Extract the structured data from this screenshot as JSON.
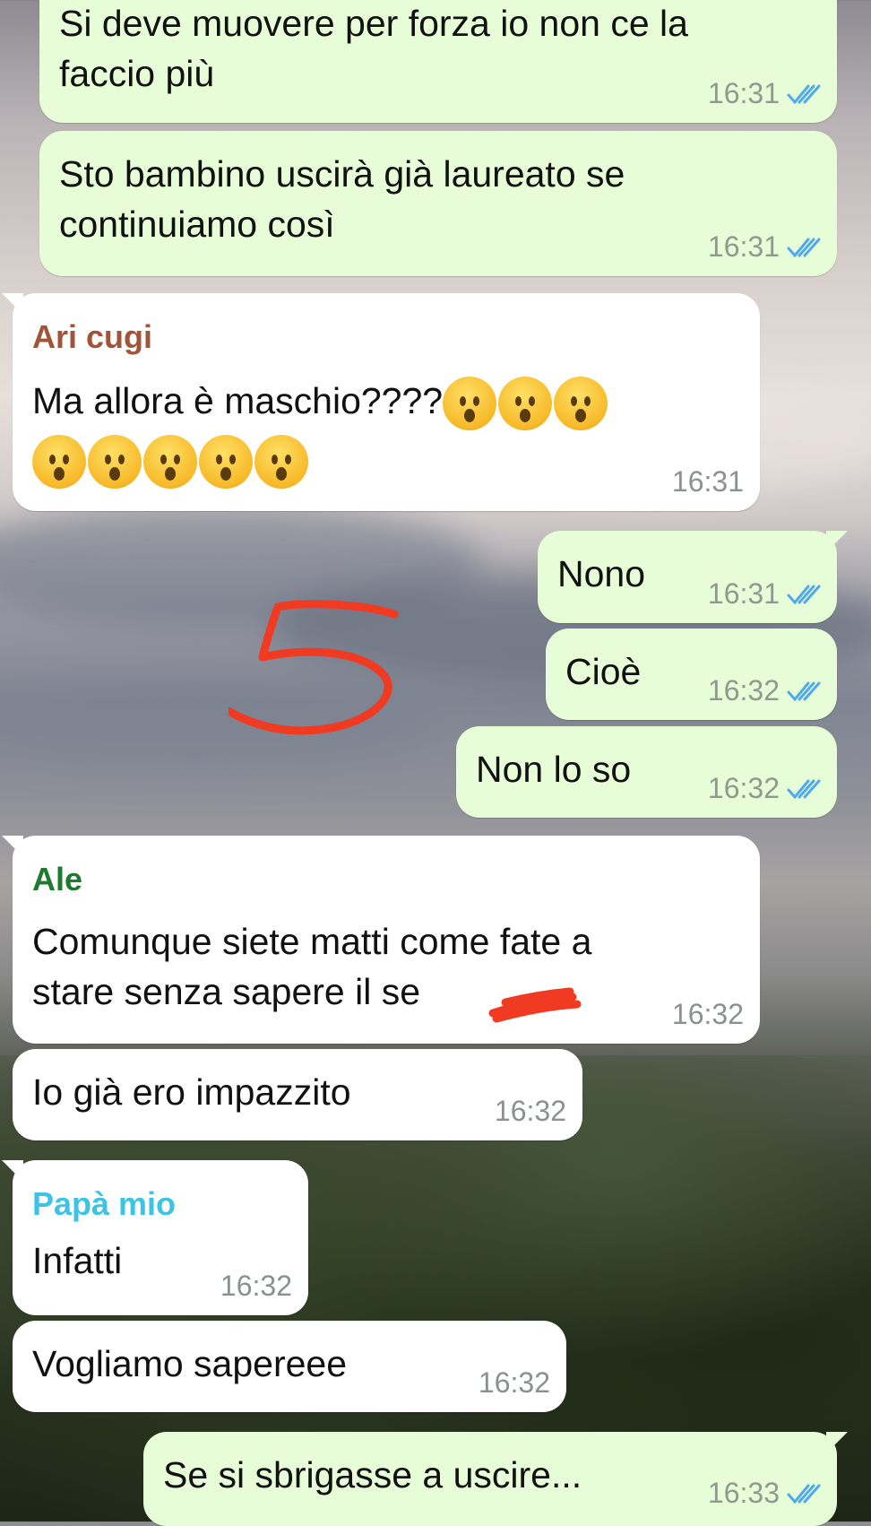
{
  "accent": {
    "out_bubble": "#e7fdd8",
    "in_bubble": "#ffffff",
    "tick_color": "#4fa9ec",
    "scribble": "#f03a22"
  },
  "messages": [
    {
      "text": "Si deve muovere per forza io non ce la\nfaccio più",
      "time": "16:31"
    },
    {
      "text": "Sto bambino uscirà già laureato se\ncontinuiamo così",
      "time": "16:31"
    },
    {
      "sender": "Ari cugi",
      "sender_color": "#a0553b",
      "text": "Ma allora è maschio????",
      "emoji_count": 8,
      "emoji_name": "astonished-face",
      "time": "16:31"
    },
    {
      "text": "Nono",
      "time": "16:31"
    },
    {
      "text": "Cioè",
      "time": "16:32"
    },
    {
      "text": "Non lo so",
      "time": "16:32"
    },
    {
      "sender": "Ale",
      "sender_color": "#1e7a2e",
      "text": "Comunque siete matti come fate a\nstare senza sapere il se",
      "time": "16:32"
    },
    {
      "text": "Io già ero impazzito",
      "time": "16:32"
    },
    {
      "sender": "Papà mio",
      "sender_color": "#3cc3e6",
      "text": "Infatti",
      "time": "16:32"
    },
    {
      "text": "Vogliamo sapereee",
      "time": "16:32"
    },
    {
      "text": "Se si sbrigasse a uscire...",
      "time": "16:33"
    }
  ],
  "annotation": {
    "drawn_number": "5"
  }
}
